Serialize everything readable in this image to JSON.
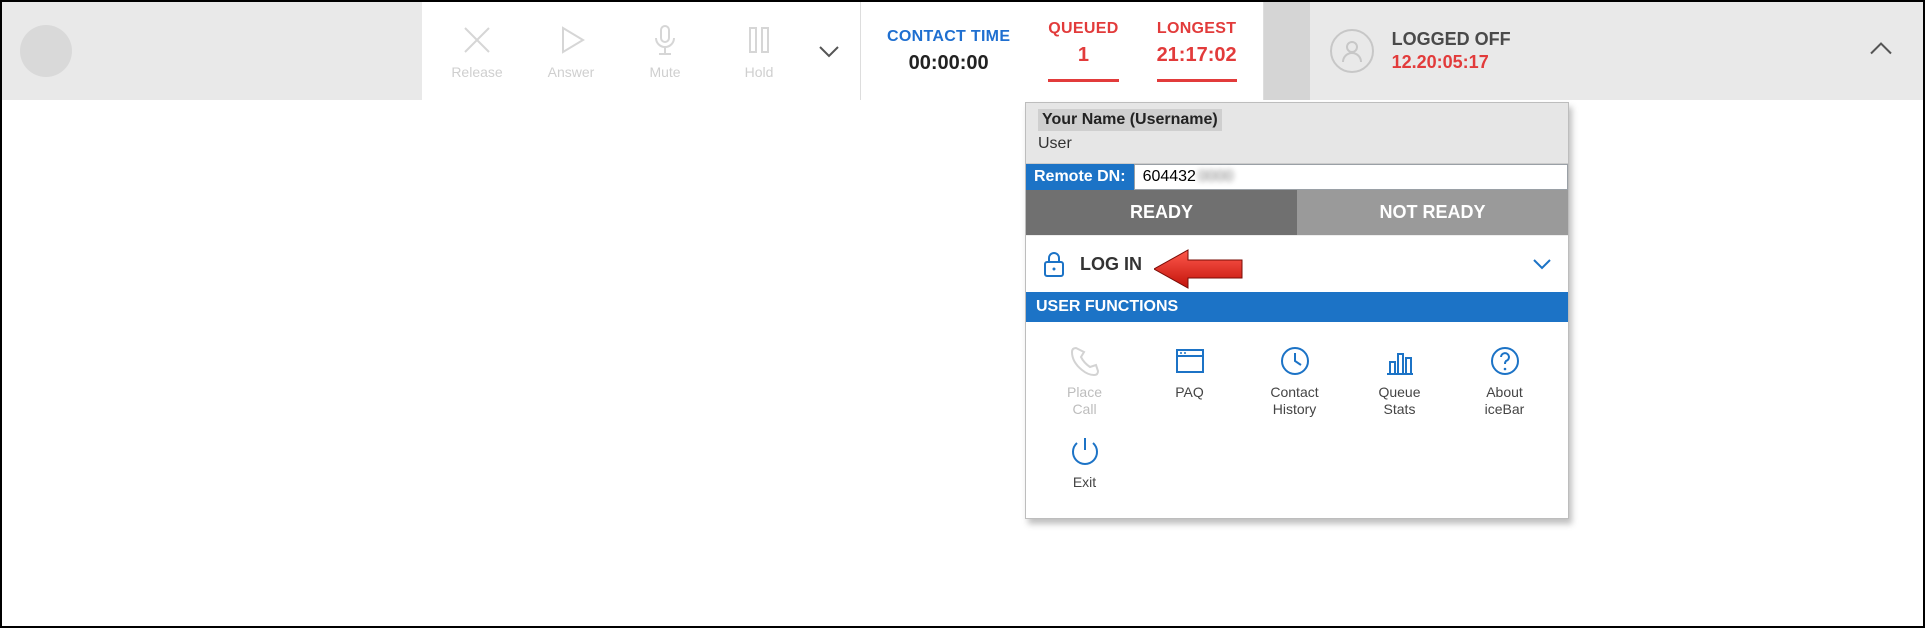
{
  "callControls": {
    "release": "Release",
    "answer": "Answer",
    "mute": "Mute",
    "hold": "Hold"
  },
  "stats": {
    "contactTime": {
      "label": "CONTACT TIME",
      "value": "00:00:00"
    },
    "queued": {
      "label": "QUEUED",
      "value": "1"
    },
    "longest": {
      "label": "LONGEST",
      "value": "21:17:02"
    }
  },
  "agentStatus": {
    "state": "LOGGED OFF",
    "timer": "12.20:05:17"
  },
  "dropdown": {
    "name": "Your Name (Username)",
    "role": "User",
    "remoteDnLabel": "Remote DN:",
    "remoteDnValueVisible": "604432",
    "toggles": {
      "ready": "READY",
      "notReady": "NOT READY"
    },
    "login": "LOG IN",
    "userFunctionsTitle": "USER FUNCTIONS",
    "funcs": {
      "placeCall": "Place\nCall",
      "paq": "PAQ",
      "contactHistory": "Contact\nHistory",
      "queueStats": "Queue\nStats",
      "aboutIceBar": "About\niceBar",
      "exit": "Exit"
    }
  }
}
